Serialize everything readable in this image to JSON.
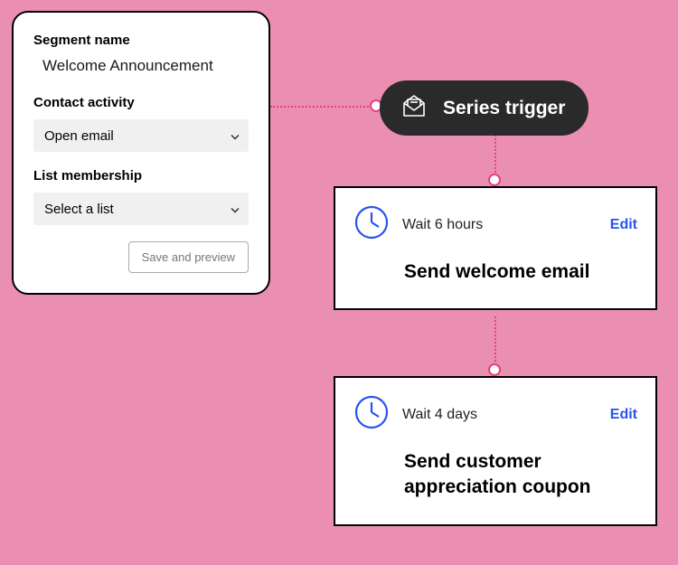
{
  "segment": {
    "name_label": "Segment name",
    "name_value": "Welcome  Announcement",
    "activity_label": "Contact activity",
    "activity_value": "Open email",
    "list_label": "List membership",
    "list_placeholder": "Select a list",
    "save_label": "Save and preview"
  },
  "trigger": {
    "title": "Series trigger"
  },
  "steps": [
    {
      "wait": "Wait 6 hours",
      "title": "Send welcome email",
      "edit": "Edit"
    },
    {
      "wait": "Wait 4 days",
      "title": "Send customer appreciation coupon",
      "edit": "Edit"
    }
  ]
}
